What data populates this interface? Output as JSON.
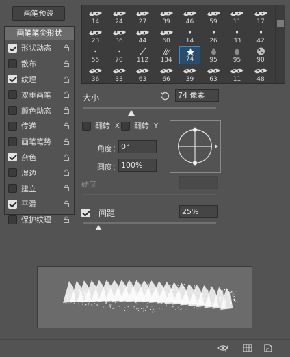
{
  "left_panel": {
    "preset_button": "画笔预设",
    "tip_shape": "画笔笔尖形状",
    "options": [
      {
        "label": "形状动态",
        "checked": true
      },
      {
        "label": "散布",
        "checked": false
      },
      {
        "label": "纹理",
        "checked": true
      },
      {
        "label": "双重画笔",
        "checked": false
      },
      {
        "label": "颜色动态",
        "checked": false
      },
      {
        "label": "传递",
        "checked": false
      },
      {
        "label": "画笔笔势",
        "checked": false
      },
      {
        "label": "杂色",
        "checked": true
      },
      {
        "label": "湿边",
        "checked": false
      },
      {
        "label": "建立",
        "checked": false
      },
      {
        "label": "平滑",
        "checked": true
      },
      {
        "label": "保护纹理",
        "checked": false
      }
    ],
    "lock_icon": "lock-icon"
  },
  "brush_grid": {
    "rows": [
      [
        "14",
        "24",
        "27",
        "39",
        "46",
        "59",
        "11",
        "17"
      ],
      [
        "23",
        "36",
        "44",
        "60",
        "14",
        "26",
        "33",
        "42"
      ],
      [
        "55",
        "70",
        "112",
        "134",
        "74",
        "95",
        "95",
        "90"
      ],
      [
        "36",
        "33",
        "63",
        "66",
        "39",
        "63",
        "11",
        "48"
      ]
    ],
    "selected": "74"
  },
  "size": {
    "label": "大小",
    "value": "74 像素",
    "reset_icon": "reset-icon"
  },
  "flip": {
    "x_label": "翻转",
    "x_axis": "X",
    "y_label": "翻转",
    "y_axis": "Y"
  },
  "angle": {
    "label": "角度：",
    "value": "0°"
  },
  "roundness": {
    "label": "圆度：",
    "value": "100%"
  },
  "hardness": {
    "label": "硬度"
  },
  "spacing": {
    "label": "间距",
    "value": "25%",
    "checked": true
  },
  "bottom_icons": [
    "eye-toggle-icon",
    "grid-icon",
    "new-preset-icon"
  ]
}
